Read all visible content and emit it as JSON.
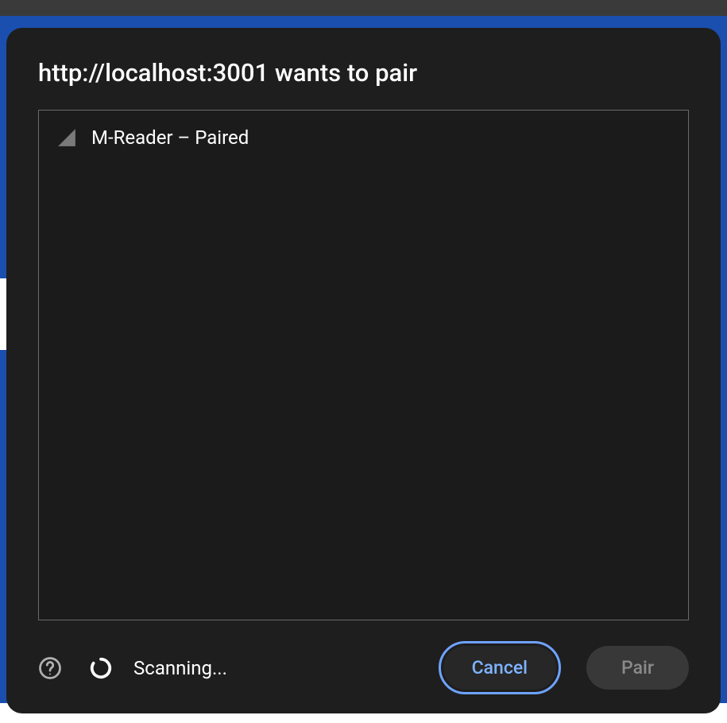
{
  "modal": {
    "title": "http://localhost:3001 wants to pair",
    "devices": [
      {
        "label": "M-Reader – Paired"
      }
    ],
    "status": "Scanning...",
    "cancel_label": "Cancel",
    "pair_label": "Pair"
  }
}
